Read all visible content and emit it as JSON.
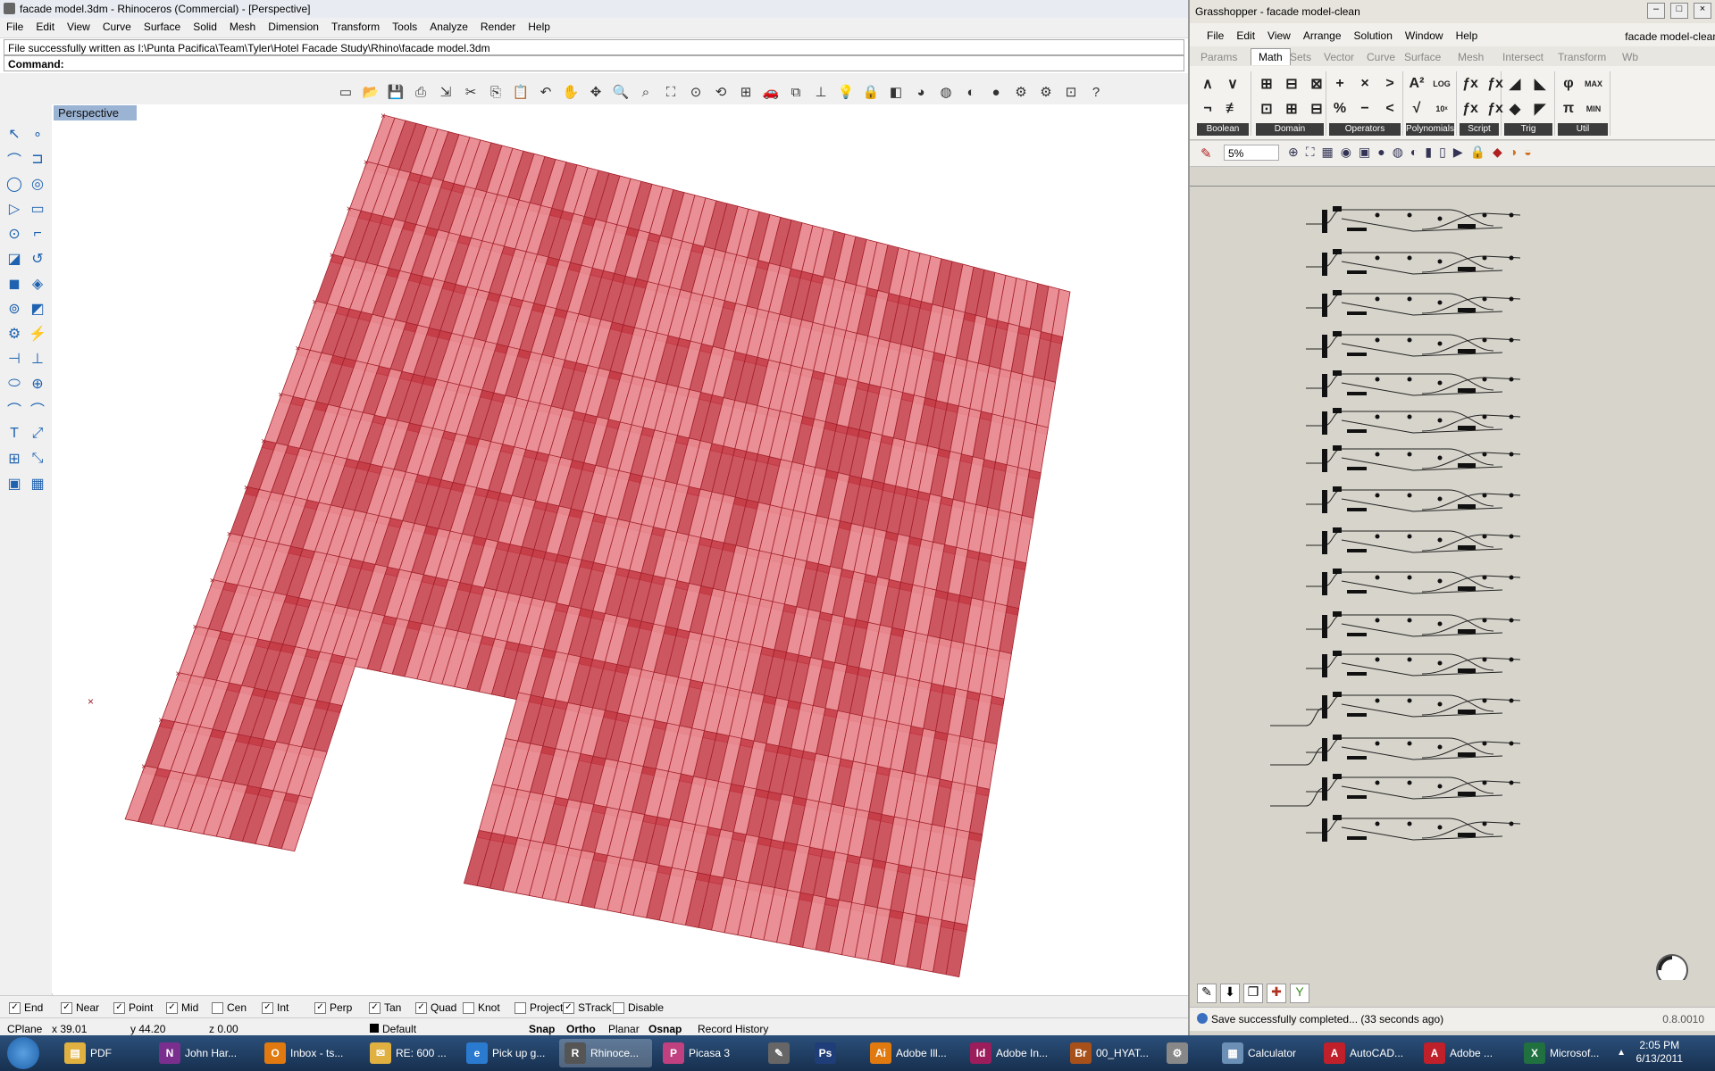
{
  "rhino": {
    "title": "facade model.3dm - Rhinoceros (Commercial) - [Perspective]",
    "menu": [
      "File",
      "Edit",
      "View",
      "Curve",
      "Surface",
      "Solid",
      "Mesh",
      "Dimension",
      "Transform",
      "Tools",
      "Analyze",
      "Render",
      "Help"
    ],
    "command_history": "File successfully written as I:\\Punta Pacifica\\Team\\Tyler\\Hotel Facade Study\\Rhino\\facade model.3dm",
    "command_prompt": "Command:",
    "viewport_label": "Perspective",
    "toolbar_icons": [
      "new-icon",
      "open-icon",
      "save-icon",
      "print-icon",
      "import-icon",
      "cut-icon",
      "copy-icon",
      "paste-icon",
      "undo-icon",
      "pan-icon",
      "move-view-icon",
      "zoom-icon",
      "zoom-window-icon",
      "zoom-extents-icon",
      "zoom-selected-icon",
      "rotate-view-icon",
      "four-viewports-icon",
      "car-icon",
      "cplane-icon",
      "ortho-icon",
      "light-icon",
      "lock-icon",
      "layer-icon",
      "color-icon",
      "shade-icon",
      "render-preview-icon",
      "render-sphere-icon",
      "flamingo-icon",
      "options-icon",
      "snap-icon",
      "help-icon"
    ],
    "osnaps": [
      {
        "label": "End",
        "checked": true
      },
      {
        "label": "Near",
        "checked": true
      },
      {
        "label": "Point",
        "checked": true
      },
      {
        "label": "Mid",
        "checked": true
      },
      {
        "label": "Cen",
        "checked": false
      },
      {
        "label": "Int",
        "checked": true
      },
      {
        "label": "Perp",
        "checked": true
      },
      {
        "label": "Tan",
        "checked": true
      },
      {
        "label": "Quad",
        "checked": true
      },
      {
        "label": "Knot",
        "checked": false
      },
      {
        "label": "Project",
        "checked": false
      },
      {
        "label": "STrack",
        "checked": true
      },
      {
        "label": "Disable",
        "checked": false
      }
    ],
    "status": {
      "cplane": "CPlane",
      "x": "x 39.01",
      "y": "y 44.20",
      "z": "z 0.00",
      "layer": "Default",
      "snap": "Snap",
      "ortho": "Ortho",
      "planar": "Planar",
      "osnap": "Osnap",
      "record_history": "Record History"
    },
    "colors": {
      "facade": "#e8898f",
      "facade_dark": "#c43a44",
      "edge": "#a3202b"
    }
  },
  "grasshopper": {
    "title": "Grasshopper - facade model-clean",
    "doc_name": "facade model-clean",
    "menu": [
      "File",
      "Edit",
      "View",
      "Arrange",
      "Solution",
      "Window",
      "Help"
    ],
    "tabs": [
      "Params",
      "Math",
      "Sets",
      "Vector",
      "Curve",
      "Surface",
      "Mesh",
      "Intersect",
      "Transform",
      "Wb"
    ],
    "active_tab": "Math",
    "groups": [
      {
        "label": "Boolean",
        "icons": [
          "∧",
          "∨",
          "¬",
          "≢"
        ]
      },
      {
        "label": "Domain",
        "icons": [
          "⊞",
          "⊟",
          "⊠",
          "⊡",
          "⊞",
          "⊟"
        ]
      },
      {
        "label": "Operators",
        "icons": [
          "+",
          "×",
          ">",
          "%",
          "−",
          "<"
        ]
      },
      {
        "label": "Polynomials",
        "icons": [
          "A²",
          "LOG",
          "√",
          "10ˣ"
        ]
      },
      {
        "label": "Script",
        "icons": [
          "ƒx",
          "ƒx",
          "ƒx",
          "ƒx"
        ]
      },
      {
        "label": "Trig",
        "icons": [
          "◢",
          "◣",
          "◆",
          "◤"
        ]
      },
      {
        "label": "Util",
        "icons": [
          "φ",
          "MAX",
          "π",
          "MIN"
        ]
      }
    ],
    "zoom": "5%",
    "status_text": "Save successfully completed... (33 seconds ago)",
    "version": "0.8.0010"
  },
  "taskbar": {
    "items": [
      {
        "label": "PDF",
        "icon": "folder-icon",
        "color": "#e0b040"
      },
      {
        "label": "John Har...",
        "icon": "onenote-icon",
        "color": "#7a2f8f"
      },
      {
        "label": "Inbox - ts...",
        "icon": "outlook-icon",
        "color": "#e07a10"
      },
      {
        "label": "RE: 600 ...",
        "icon": "mail-icon",
        "color": "#e0b040"
      },
      {
        "label": "Pick up g...",
        "icon": "ie-icon",
        "color": "#2a7ad0"
      },
      {
        "label": "Rhinoce...",
        "icon": "rhino-icon",
        "color": "#555555"
      },
      {
        "label": "Picasa 3",
        "icon": "picasa-icon",
        "color": "#c04080"
      },
      {
        "label": "",
        "icon": "pen-icon",
        "color": "#666666"
      },
      {
        "label": "",
        "icon": "photoshop-icon",
        "color": "#1f3d78"
      },
      {
        "label": "Adobe Ill...",
        "icon": "illustrator-icon",
        "color": "#e07a10"
      },
      {
        "label": "Adobe In...",
        "icon": "indesign-icon",
        "color": "#9b1d5c"
      },
      {
        "label": "00_HYAT...",
        "icon": "bridge-icon",
        "color": "#a8501a"
      },
      {
        "label": "",
        "icon": "settings-icon",
        "color": "#888888"
      },
      {
        "label": "Calculator",
        "icon": "calculator-icon",
        "color": "#6b8fb5"
      },
      {
        "label": "AutoCAD...",
        "icon": "autocad-icon",
        "color": "#c0202a"
      },
      {
        "label": "Adobe ...",
        "icon": "acrobat-icon",
        "color": "#c0202a"
      },
      {
        "label": "Microsof...",
        "icon": "excel-icon",
        "color": "#207040"
      }
    ],
    "time": "2:05 PM",
    "date": "6/13/2011"
  }
}
